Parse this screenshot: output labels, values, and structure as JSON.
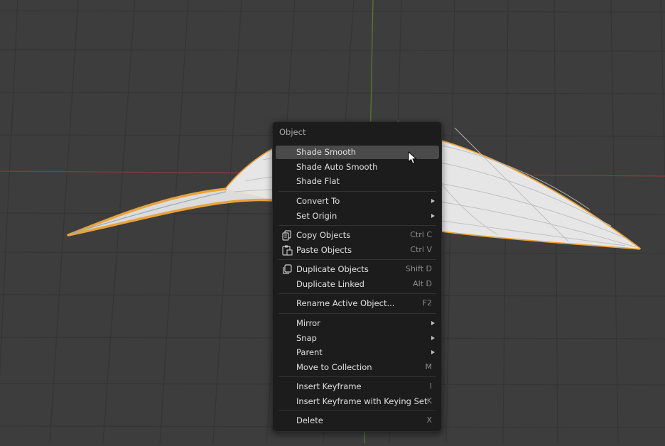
{
  "menu": {
    "title": "Object",
    "items": [
      {
        "label": "Shade Smooth",
        "shortcut": "",
        "submenu": false,
        "icon": null,
        "active": true
      },
      {
        "label": "Shade Auto Smooth",
        "shortcut": "",
        "submenu": false,
        "icon": null,
        "active": false
      },
      {
        "label": "Shade Flat",
        "shortcut": "",
        "submenu": false,
        "icon": null,
        "active": false
      },
      {
        "label": "Convert To",
        "shortcut": "",
        "submenu": true,
        "icon": null,
        "active": false
      },
      {
        "label": "Set Origin",
        "shortcut": "",
        "submenu": true,
        "icon": null,
        "active": false
      },
      {
        "label": "Copy Objects",
        "shortcut": "Ctrl C",
        "submenu": false,
        "icon": "copy-icon",
        "active": false
      },
      {
        "label": "Paste Objects",
        "shortcut": "Ctrl V",
        "submenu": false,
        "icon": "paste-icon",
        "active": false
      },
      {
        "label": "Duplicate Objects",
        "shortcut": "Shift D",
        "submenu": false,
        "icon": "duplicate-icon",
        "active": false
      },
      {
        "label": "Duplicate Linked",
        "shortcut": "Alt D",
        "submenu": false,
        "icon": null,
        "active": false
      },
      {
        "label": "Rename Active Object...",
        "shortcut": "F2",
        "submenu": false,
        "icon": null,
        "active": false
      },
      {
        "label": "Mirror",
        "shortcut": "",
        "submenu": true,
        "icon": null,
        "active": false
      },
      {
        "label": "Snap",
        "shortcut": "",
        "submenu": true,
        "icon": null,
        "active": false
      },
      {
        "label": "Parent",
        "shortcut": "",
        "submenu": true,
        "icon": null,
        "active": false
      },
      {
        "label": "Move to Collection",
        "shortcut": "M",
        "submenu": false,
        "icon": null,
        "active": false
      },
      {
        "label": "Insert Keyframe",
        "shortcut": "I",
        "submenu": false,
        "icon": null,
        "active": false
      },
      {
        "label": "Insert Keyframe with Keying Set",
        "shortcut": "K",
        "submenu": false,
        "icon": null,
        "active": false
      },
      {
        "label": "Delete",
        "shortcut": "X",
        "submenu": false,
        "icon": null,
        "active": false
      }
    ]
  },
  "colors": {
    "viewport_bg": "#3d3d3d",
    "grid": "#353535",
    "x_axis": "#8a3b3b",
    "y_axis": "#5f7a2e",
    "selection_outline": "#e8a33a",
    "menu_bg": "#1c1c1c",
    "active_item_bg": "#4a4a4a"
  }
}
